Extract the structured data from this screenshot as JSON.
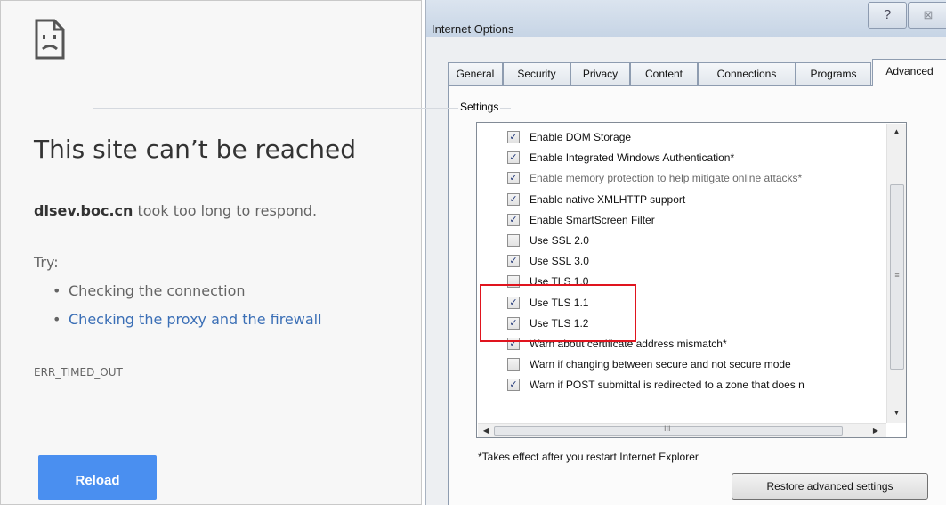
{
  "chrome_error": {
    "title": "This site can’t be reached",
    "host": "dlsev.boc.cn",
    "description_rest": " took too long to respond.",
    "try_label": "Try:",
    "suggestions": [
      "Checking the connection",
      "Checking the proxy and the firewall"
    ],
    "error_code": "ERR_TIMED_OUT",
    "reload_label": "Reload",
    "link_color": "#3b6fb6",
    "button_color": "#4a8ff0"
  },
  "dialog": {
    "title": "Internet Options",
    "help_glyph": "?",
    "close_glyph": "⊠",
    "tabs": [
      "General",
      "Security",
      "Privacy",
      "Content",
      "Connections",
      "Programs",
      "Advanced"
    ],
    "active_tab": "Advanced",
    "settings_label": "Settings",
    "options": [
      {
        "label": "Enable DOM Storage",
        "checked": true
      },
      {
        "label": "Enable Integrated Windows Authentication*",
        "checked": true
      },
      {
        "label": "Enable memory protection to help mitigate online attacks*",
        "checked": true,
        "disabled": true
      },
      {
        "label": "Enable native XMLHTTP support",
        "checked": true
      },
      {
        "label": "Enable SmartScreen Filter",
        "checked": true
      },
      {
        "label": "Use SSL 2.0",
        "checked": false
      },
      {
        "label": "Use SSL 3.0",
        "checked": true
      },
      {
        "label": "Use TLS 1.0",
        "checked": false
      },
      {
        "label": "Use TLS 1.1",
        "checked": true
      },
      {
        "label": "Use TLS 1.2",
        "checked": true
      },
      {
        "label": "Warn about certificate address mismatch*",
        "checked": true
      },
      {
        "label": "Warn if changing between secure and not secure mode",
        "checked": false
      },
      {
        "label": "Warn if POST submittal is redirected to a zone that does n",
        "checked": true
      }
    ],
    "restart_note": "*Takes effect after you restart Internet Explorer",
    "restore_label": "Restore advanced settings",
    "scroll_grip_glyph": "≡",
    "hscroll_grip_glyph": "III",
    "highlight_color": "#e0141e"
  }
}
